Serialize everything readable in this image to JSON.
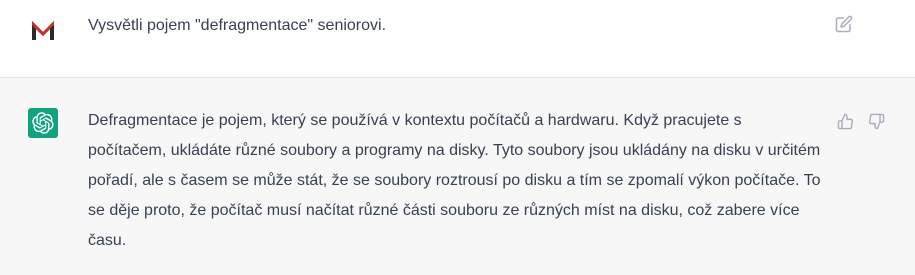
{
  "conversation": {
    "user_message": {
      "avatar_icon": "m-logo-icon",
      "text": "Vysvětli pojem \"defragmentace\" seniorovi.",
      "edit_icon": "edit-icon"
    },
    "assistant_message": {
      "avatar_icon": "openai-logo-icon",
      "text": "Defragmentace je pojem, který se používá v kontextu počítačů a hardwaru. Když pracujete s počítačem, ukládáte různé soubory a programy na disky. Tyto soubory jsou ukládány na disku v určitém pořadí, ale s časem se může stát, že se soubory roztrousí po disku a tím se zpomalí výkon počítače. To se děje proto, že počítač musí načítat různé části souboru ze různých míst na disku, což zabere více času.",
      "feedback_icons": [
        "thumbs-up-icon",
        "thumbs-down-icon"
      ]
    }
  },
  "colors": {
    "assistant_avatar_bg": "#10a37f",
    "assistant_row_bg": "#f7f7f8",
    "logo_red": "#c8312b",
    "logo_dark": "#2b2b2b",
    "icon_gray": "#acacbe"
  }
}
